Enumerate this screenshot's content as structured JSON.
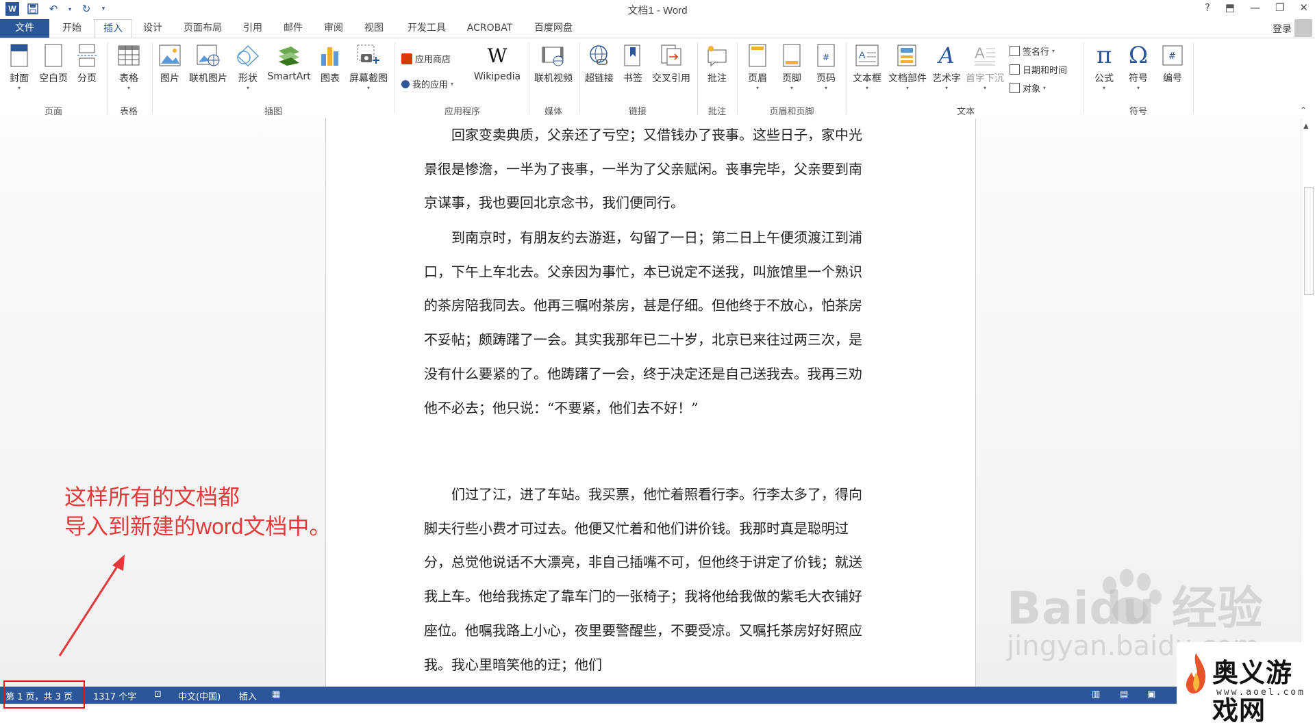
{
  "window": {
    "title": "文档1 - Word",
    "controls": [
      "?",
      "⬒",
      "—",
      "❐",
      "✕"
    ]
  },
  "quick_access": {
    "save_icon": "save-icon",
    "undo_icon": "undo-icon",
    "redo_icon": "redo-icon"
  },
  "tabs": [
    "文件",
    "开始",
    "插入",
    "设计",
    "页面布局",
    "引用",
    "邮件",
    "审阅",
    "视图",
    "开发工具",
    "ACROBAT",
    "百度网盘"
  ],
  "active_tab": "插入",
  "login": "登录",
  "ribbon": {
    "pages": {
      "cover": "封面",
      "blank": "空白页",
      "break": "分页",
      "group": "页面"
    },
    "tables": {
      "table": "表格",
      "group": "表格"
    },
    "illustrations": {
      "picture": "图片",
      "online_picture": "联机图片",
      "shapes": "形状",
      "smartart": "SmartArt",
      "chart": "图表",
      "screenshot": "屏幕截图",
      "group": "插图"
    },
    "apps": {
      "store": "应用商店",
      "my_apps": "我的应用",
      "wikipedia": "Wikipedia",
      "group": "应用程序"
    },
    "media": {
      "online_video": "联机视频",
      "group": "媒体"
    },
    "links": {
      "hyperlink": "超链接",
      "bookmark": "书签",
      "cross_ref": "交叉引用",
      "group": "链接"
    },
    "comments": {
      "comment": "批注",
      "group": "批注"
    },
    "header_footer": {
      "header": "页眉",
      "footer": "页脚",
      "page_number": "页码",
      "group": "页眉和页脚"
    },
    "text": {
      "textbox": "文本框",
      "quick_parts": "文档部件",
      "wordart": "艺术字",
      "dropcap": "首字下沉",
      "signature": "签名行",
      "datetime": "日期和时间",
      "object": "对象",
      "group": "文本"
    },
    "symbols": {
      "equation": "公式",
      "symbol": "符号",
      "number": "编号",
      "group": "符号"
    }
  },
  "document": {
    "paragraphs": [
      "回家变卖典质，父亲还了亏空；又借钱办了丧事。这些日子，家中光景很是惨澹，一半为了丧事，一半为了父亲赋闲。丧事完毕，父亲要到南京谋事，我也要回北京念书，我们便同行。",
      "到南京时，有朋友约去游逛，勾留了一日；第二日上午便须渡江到浦口，下午上车北去。父亲因为事忙，本已说定不送我，叫旅馆里一个熟识的茶房陪我同去。他再三嘱咐茶房，甚是仔细。但他终于不放心，怕茶房不妥帖；颇踌躇了一会。其实我那年已二十岁，北京已来往过两三次，是没有什么要紧的了。他踌躇了一会，终于决定还是自己送我去。我再三劝他不必去；他只说：“不要紧，他们去不好！”",
      "们过了江，进了车站。我买票，他忙着照看行李。行李太多了，得向脚夫行些小费才可过去。他便又忙着和他们讲价钱。我那时真是聪明过分，总觉他说话不大漂亮，非自己插嘴不可，但他终于讲定了价钱；就送我上车。他给我拣定了靠车门的一张椅子；我将他给我做的紫毛大衣铺好座位。他嘱我路上小心，夜里要警醒些，不要受凉。又嘱托茶房好好照应我。我心里暗笑他的迂；他们"
    ]
  },
  "status": {
    "page": "第 1 页，共 3 页",
    "words": "1317 个字",
    "language": "中文(中国)",
    "mode": "插入"
  },
  "annotation": {
    "line1": "这样所有的文档都",
    "line2": "导入到新建的word文档中。"
  },
  "watermark": {
    "brand": "Baidu",
    "brand_cn": "经验",
    "url": "jingyan.baidu.com"
  },
  "logo": {
    "text": "奥义游戏网",
    "url": "www.aoel.com"
  }
}
